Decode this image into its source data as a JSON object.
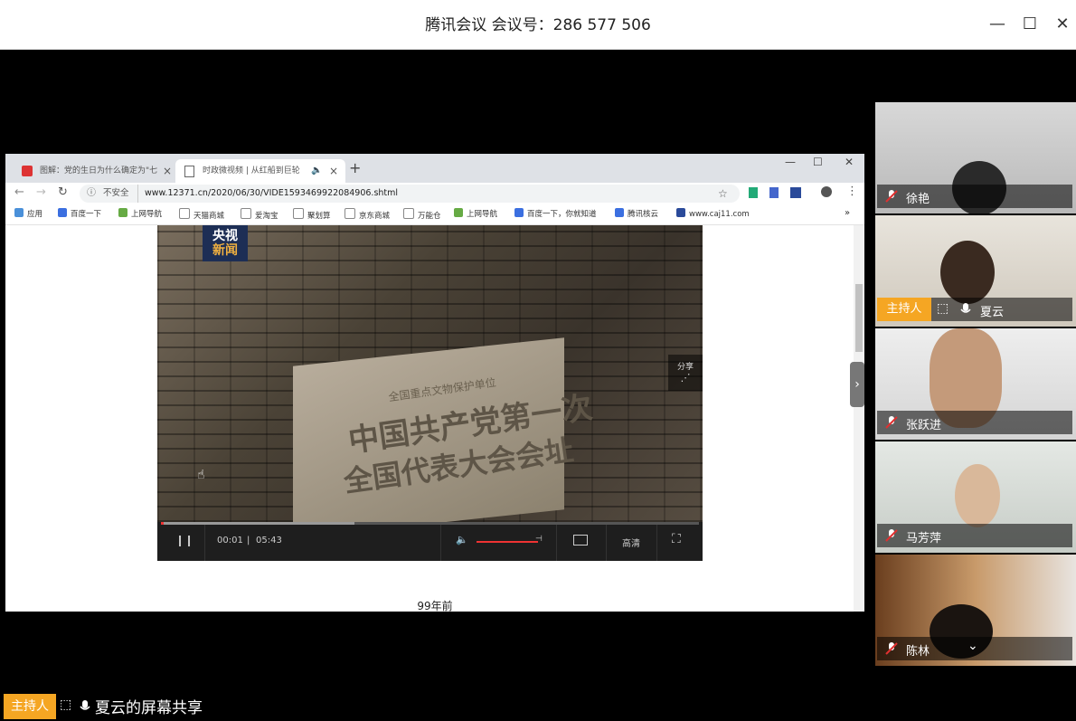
{
  "window": {
    "title": "腾讯会议 会议号：286 577 506",
    "controls": {
      "minimize": "—",
      "maximize": "☐",
      "close": "✕"
    }
  },
  "browser": {
    "tabs": [
      {
        "label": "图解：党的生日为什么确定为\"七",
        "close": "×"
      },
      {
        "label": "时政微视频 | 从红船到巨轮",
        "close": "×"
      }
    ],
    "new_tab": "+",
    "security_label": "不安全",
    "url": "www.12371.cn/2020/06/30/VIDE1593469922084906.shtml",
    "bookmarks": [
      "应用",
      "百度一下",
      "上网导航",
      "天猫商城",
      "爱淘宝",
      "聚划算",
      "京东商城",
      "万能仓",
      "上网导航",
      "百度一下，你就知道",
      "腾讯核云",
      "www.caj11.com"
    ],
    "more_bookmarks": "»"
  },
  "video": {
    "logo_line1": "央视",
    "logo_line2": "新闻",
    "plaque_small": "全国重点文物保护单位",
    "plaque_line1": "中国共产党第一次",
    "plaque_line2": "全国代表大会会址",
    "share_label": "分享",
    "current_time": "00:01",
    "time_sep": "|",
    "duration": "05:43",
    "progress_fraction": 0.003,
    "buffered_fraction": 0.36,
    "volume_fraction": 1.0,
    "quality_label": "高清",
    "caption": "99年前"
  },
  "participants": [
    {
      "name": "徐艳",
      "host": false,
      "sharing": false
    },
    {
      "name": "夏云",
      "host": true,
      "sharing": true
    },
    {
      "name": "张跃进",
      "host": false,
      "sharing": false
    },
    {
      "name": "马芳萍",
      "host": false,
      "sharing": false
    },
    {
      "name": "陈林",
      "host": false,
      "sharing": false
    }
  ],
  "host_badge": "主持人",
  "share_status": {
    "host_label": "主持人",
    "text": "夏云的屏幕共享"
  },
  "colors": {
    "host_badge": "#f5a623",
    "mic_muted": "#e03030",
    "progress": "#e33"
  }
}
